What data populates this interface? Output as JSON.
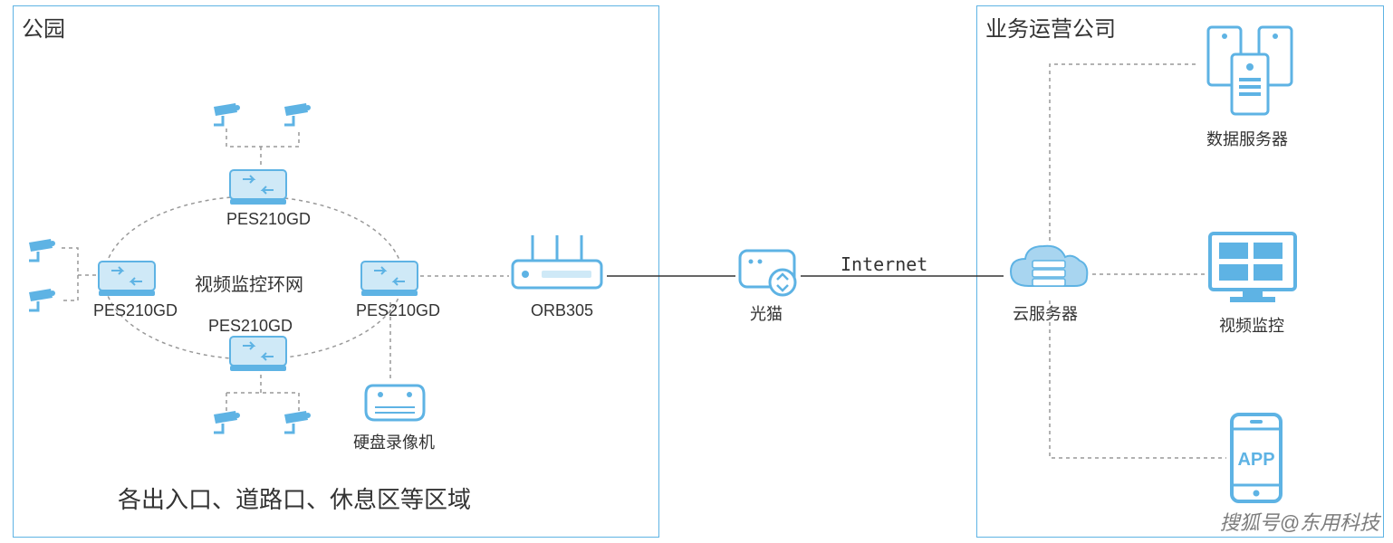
{
  "left_box_title": "公园",
  "right_box_title": "业务运营公司",
  "ring_network_label": "视频监控环网",
  "switch_label_1": "PES210GD",
  "switch_label_2": "PES210GD",
  "switch_label_3": "PES210GD",
  "switch_label_4": "PES210GD",
  "router_label": "ORB305",
  "dvr_label": "硬盘录像机",
  "modem_label": "光猫",
  "internet_label": "Internet",
  "cloud_label": "云服务器",
  "data_server_label": "数据服务器",
  "video_monitor_label": "视频监控",
  "app_label": "APP",
  "areas_label": "各出入口、道路口、休息区等区域",
  "watermark": "搜狐号@东用科技",
  "colors": {
    "primary": "#5eb3e4",
    "light": "#a8d5f0",
    "text": "#333"
  }
}
